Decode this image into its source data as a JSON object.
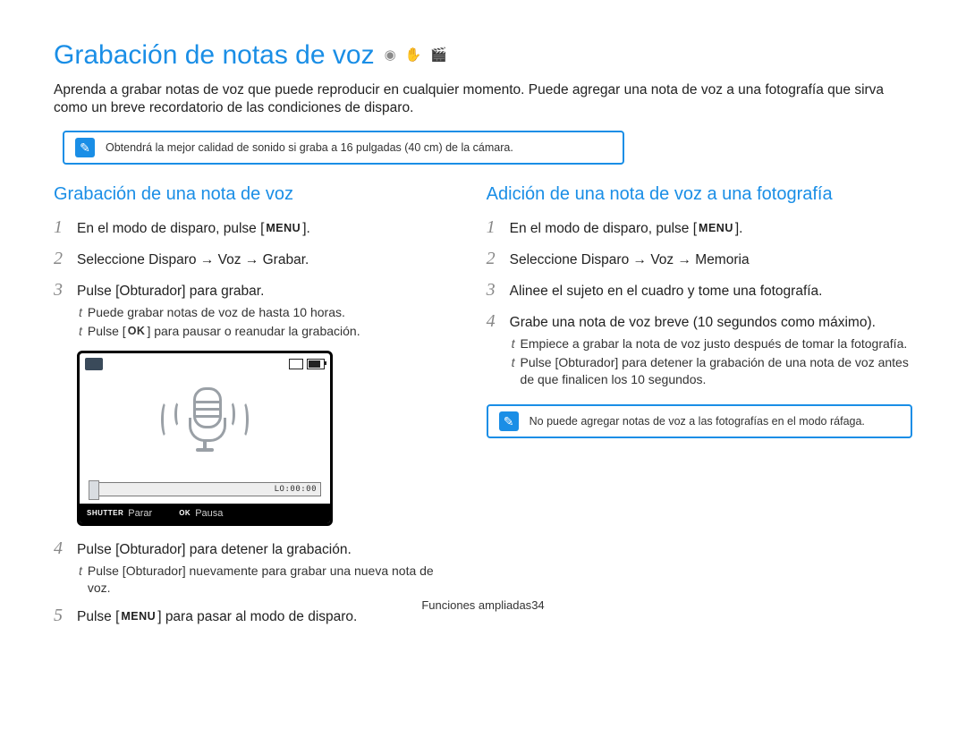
{
  "title": "Grabación de notas de voz",
  "intro": "Aprenda a grabar notas de voz que puede reproducir en cualquier momento. Puede agregar una nota de voz a una fotografía que sirva como un breve recordatorio de las condiciones de disparo.",
  "top_note": "Obtendrá la mejor calidad de sonido si graba a 16 pulgadas (40 cm) de la cámara.",
  "buttons": {
    "menu": "MENU",
    "ok": "OK"
  },
  "left": {
    "heading": "Grabación de una nota de voz",
    "step1": {
      "pre": "En el modo de disparo, pulse [",
      "btn": "MENU",
      "post": "]."
    },
    "step2": "Seleccione Disparo → Voz → Grabar.",
    "step3": "Pulse [Obturador] para grabar.",
    "step3_sub1": "Puede grabar notas de voz de hasta 10 horas.",
    "step3_sub2": {
      "pre": "Pulse [",
      "btn": "OK",
      "post": "] para pausar o reanudar la grabación."
    },
    "screenshot": {
      "time": "LO:00:00",
      "shutter_tag": "SHUTTER",
      "shutter_label": "Parar",
      "ok_tag": "OK",
      "ok_label": "Pausa"
    },
    "step4": "Pulse [Obturador] para detener la grabación.",
    "step4_sub1": "Pulse [Obturador] nuevamente para grabar una nueva nota de voz.",
    "step5": {
      "pre": "Pulse [",
      "btn": "MENU",
      "post": "] para pasar al modo de disparo."
    }
  },
  "right": {
    "heading": "Adición de una nota de voz a una fotografía",
    "step1": {
      "pre": "En el modo de disparo, pulse [",
      "btn": "MENU",
      "post": "]."
    },
    "step2": "Seleccione Disparo → Voz → Memoria",
    "step3": "Alinee el sujeto en el cuadro y tome una fotografía.",
    "step4": "Grabe una nota de voz breve (10 segundos como máximo).",
    "step4_sub1": "Empiece a grabar la nota de voz justo después de tomar la fotografía.",
    "step4_sub2": "Pulse [Obturador] para detener la grabación de una nota de voz antes de que finalicen los 10 segundos.",
    "note": "No puede agregar notas de voz a las fotografías en el modo ráfaga."
  },
  "footer": {
    "section": "Funciones ampliadas",
    "page": "34"
  }
}
